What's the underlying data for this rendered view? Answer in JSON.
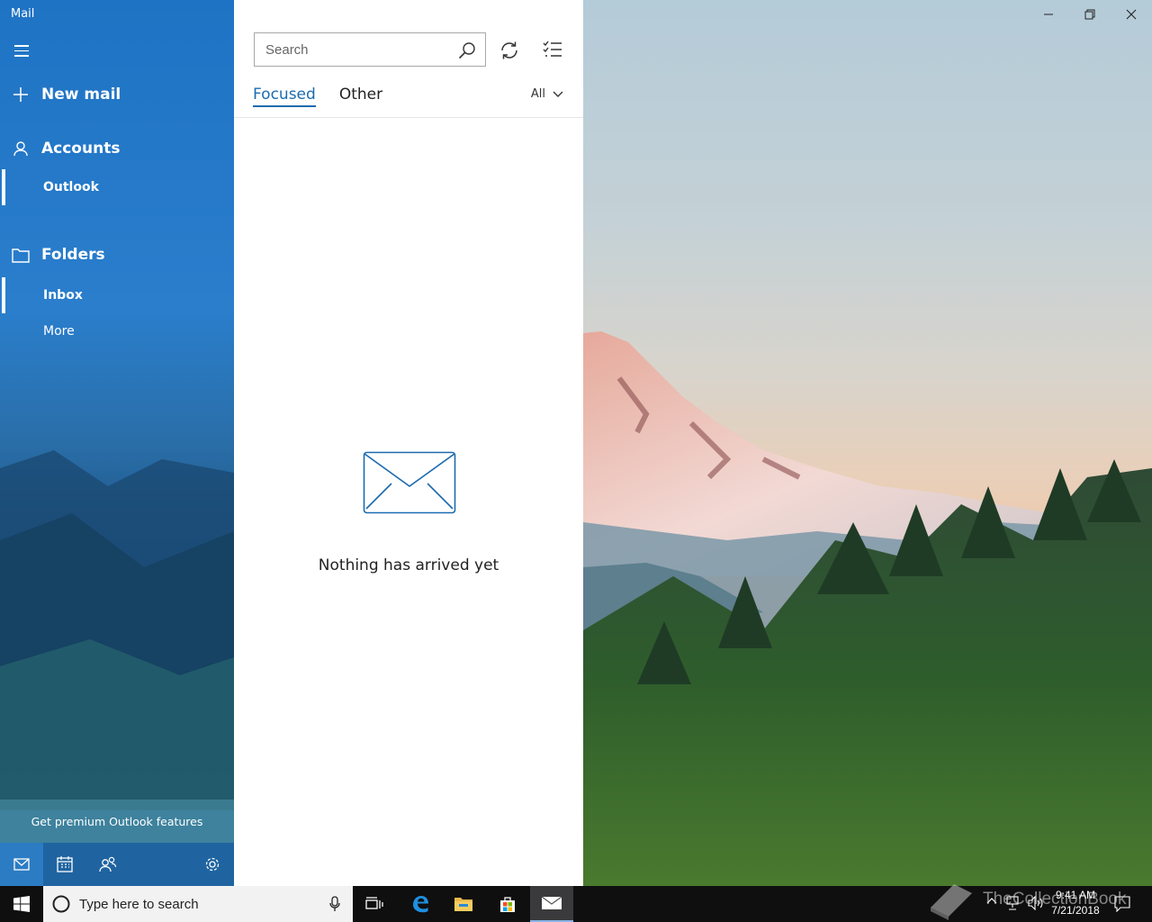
{
  "app": {
    "title": "Mail"
  },
  "sidebar": {
    "new_mail": "New mail",
    "accounts": "Accounts",
    "account_items": [
      {
        "label": "Outlook"
      }
    ],
    "folders": "Folders",
    "folder_items": [
      {
        "label": "Inbox"
      },
      {
        "label": "More"
      }
    ],
    "premium": "Get premium Outlook features",
    "bottom_icons": [
      "mail-icon",
      "calendar-icon",
      "people-icon",
      "settings-icon"
    ]
  },
  "list": {
    "search_placeholder": "Search",
    "tabs": [
      {
        "label": "Focused",
        "active": true
      },
      {
        "label": "Other",
        "active": false
      }
    ],
    "filter": "All",
    "empty_message": "Nothing has arrived yet"
  },
  "taskbar": {
    "search_placeholder": "Type here to search",
    "time": "9:41 AM",
    "date": "7/21/2018",
    "watermark": "TheCollectionBook"
  },
  "colors": {
    "accent": "#1b6bb0",
    "sidebar": "#1f73c4",
    "taskbar": "#0f0f10"
  }
}
